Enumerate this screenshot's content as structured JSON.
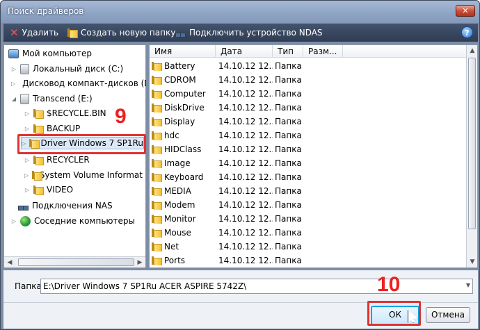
{
  "window": {
    "title": "Поиск драйверов"
  },
  "toolbar": {
    "delete": "Удалить",
    "new_folder": "Создать новую папку",
    "connect": "Подключить устройство NDAS",
    "help": "?"
  },
  "tree": [
    {
      "label": "Мой компьютер",
      "icon": "monitor-icon"
    },
    {
      "label": "Локальный диск (C:)",
      "icon": "drive-icon"
    },
    {
      "label": "Дисковод компакт-дисков (D",
      "icon": "cdrom-icon"
    },
    {
      "label": "Transcend (E:)",
      "icon": "drive-icon"
    },
    {
      "label": "$RECYCLE.BIN",
      "icon": "folder-icon"
    },
    {
      "label": "BACKUP",
      "icon": "folder-icon"
    },
    {
      "label": "Driver Windows 7 SP1Ru",
      "icon": "folder-icon"
    },
    {
      "label": "RECYCLER",
      "icon": "folder-icon"
    },
    {
      "label": "System Volume Informat",
      "icon": "folder-icon"
    },
    {
      "label": "VIDEO",
      "icon": "folder-icon"
    },
    {
      "label": "Подключения NAS",
      "icon": "network-icon"
    },
    {
      "label": "Соседние компьютеры",
      "icon": "globe-icon"
    }
  ],
  "columns": {
    "name": "Имя",
    "date": "Дата",
    "type": "Тип",
    "size": "Разм..."
  },
  "files": [
    {
      "name": "Battery",
      "date": "14.10.12 12...",
      "type": "Папка"
    },
    {
      "name": "CDROM",
      "date": "14.10.12 12...",
      "type": "Папка"
    },
    {
      "name": "Computer",
      "date": "14.10.12 12...",
      "type": "Папка"
    },
    {
      "name": "DiskDrive",
      "date": "14.10.12 12...",
      "type": "Папка"
    },
    {
      "name": "Display",
      "date": "14.10.12 12...",
      "type": "Папка"
    },
    {
      "name": "hdc",
      "date": "14.10.12 12...",
      "type": "Папка"
    },
    {
      "name": "HIDClass",
      "date": "14.10.12 12...",
      "type": "Папка"
    },
    {
      "name": "Image",
      "date": "14.10.12 12...",
      "type": "Папка"
    },
    {
      "name": "Keyboard",
      "date": "14.10.12 12...",
      "type": "Папка"
    },
    {
      "name": "MEDIA",
      "date": "14.10.12 12...",
      "type": "Папка"
    },
    {
      "name": "Modem",
      "date": "14.10.12 12...",
      "type": "Папка"
    },
    {
      "name": "Monitor",
      "date": "14.10.12 12...",
      "type": "Папка"
    },
    {
      "name": "Mouse",
      "date": "14.10.12 12...",
      "type": "Папка"
    },
    {
      "name": "Net",
      "date": "14.10.12 12...",
      "type": "Папка"
    },
    {
      "name": "Ports",
      "date": "14.10.12 12...",
      "type": "Папка"
    }
  ],
  "path": {
    "label": "Папка:",
    "value": "E:\\Driver Windows 7 SP1Ru ACER ASPIRE 5742Z\\"
  },
  "buttons": {
    "ok": "ОК",
    "cancel": "Отмена"
  },
  "annotations": {
    "step9": "9",
    "step10": "10"
  },
  "colors": {
    "annotation": "#ee2020",
    "ok_border": "#00a4e8",
    "title_bar": "#8ea3c3"
  }
}
